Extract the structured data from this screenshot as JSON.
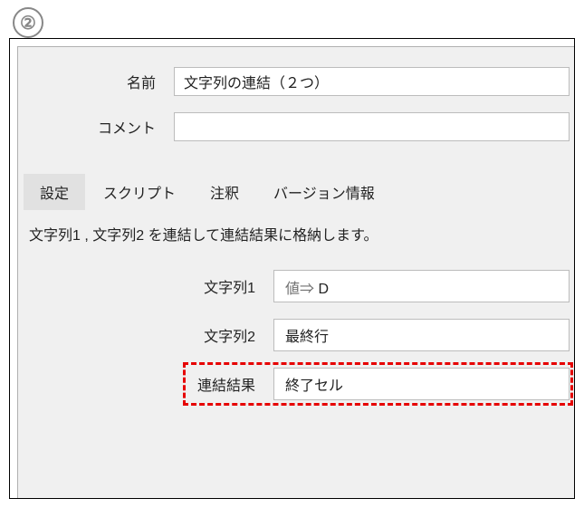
{
  "badge": "②",
  "form": {
    "name_label": "名前",
    "name_value": "文字列の連結（２つ）",
    "comment_label": "コメント",
    "comment_value": ""
  },
  "tabs": {
    "settings": "設定",
    "script": "スクリプト",
    "annotation": "注釈",
    "version": "バージョン情報"
  },
  "panel": {
    "description": "文字列1 , 文字列2 を連結して連結結果に格納します。",
    "string1_label": "文字列1",
    "string1_prefix": "値⇒",
    "string1_value": "D",
    "string2_label": "文字列2",
    "string2_value": "最終行",
    "result_label": "連結結果",
    "result_value": "終了セル"
  }
}
